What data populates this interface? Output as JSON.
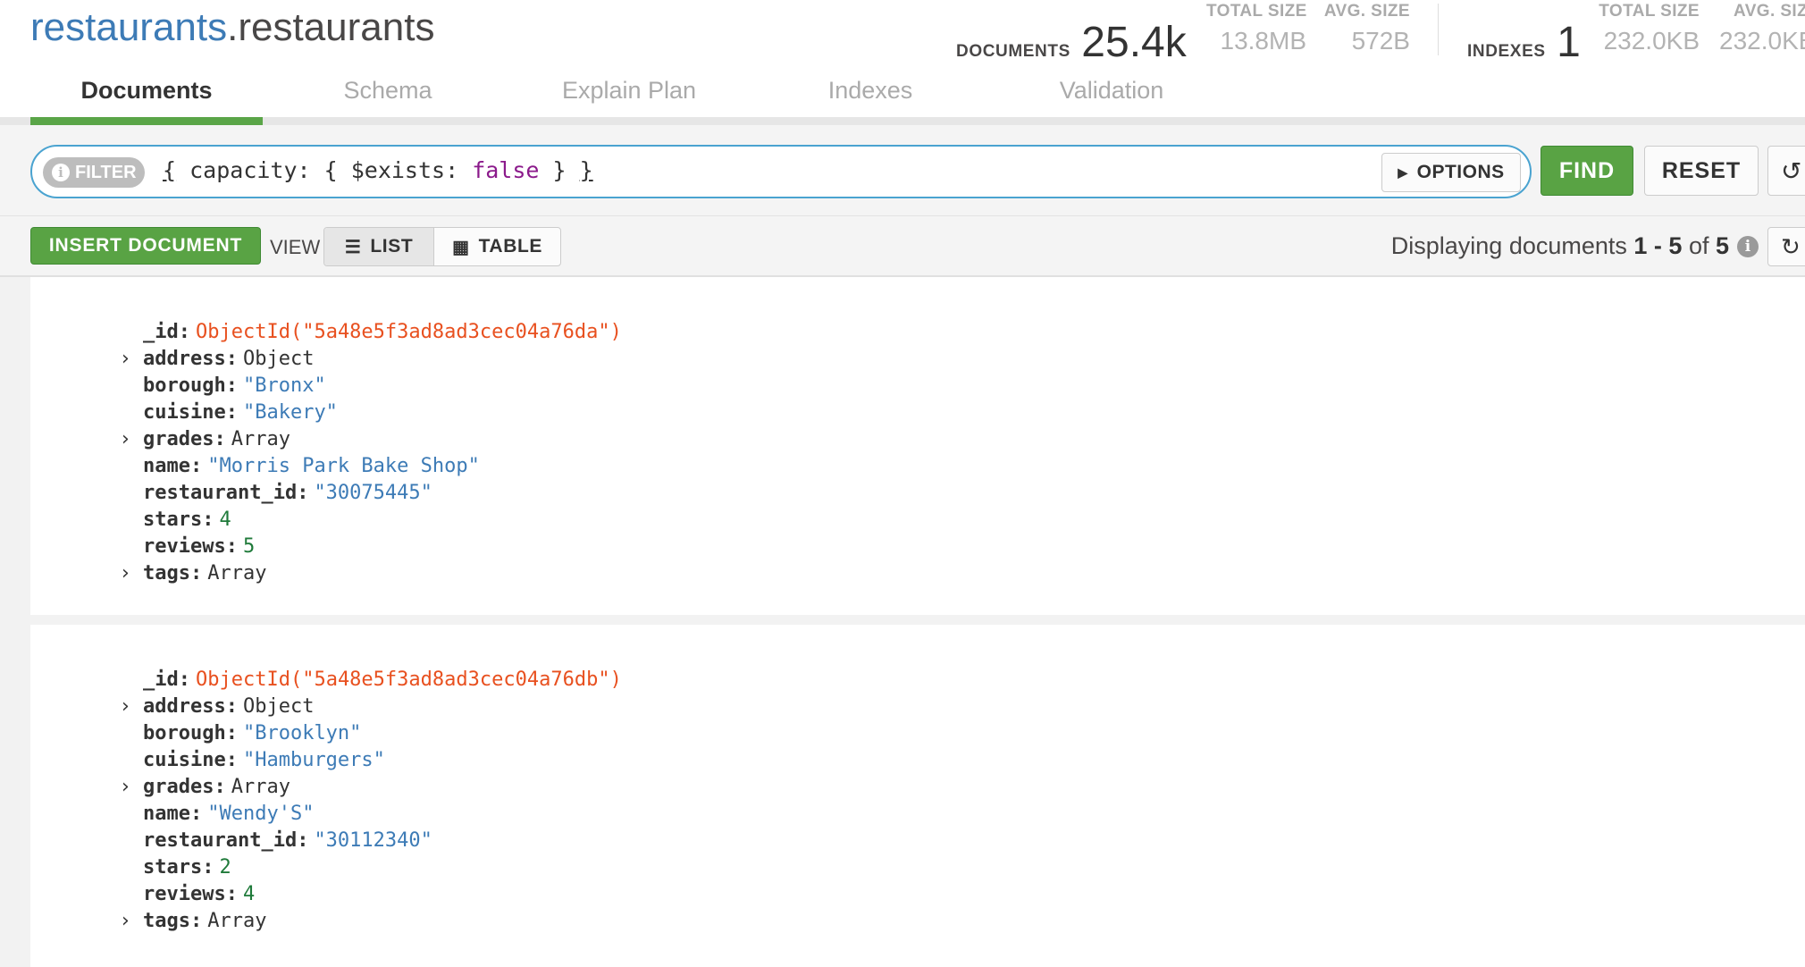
{
  "namespace": {
    "database": "restaurants",
    "separator": ".",
    "collection": "restaurants"
  },
  "stats": {
    "documents_label": "DOCUMENTS",
    "documents_value": "25.4k",
    "doc_total_size_label": "TOTAL SIZE",
    "doc_total_size_value": "13.8MB",
    "doc_avg_size_label": "AVG. SIZE",
    "doc_avg_size_value": "572B",
    "indexes_label": "INDEXES",
    "indexes_value": "1",
    "idx_total_size_label": "TOTAL SIZE",
    "idx_total_size_value": "232.0KB",
    "idx_avg_size_label": "AVG. SIZ",
    "idx_avg_size_value": "232.0KB"
  },
  "tabs": [
    {
      "label": "Documents",
      "active": true
    },
    {
      "label": "Schema",
      "active": false
    },
    {
      "label": "Explain Plan",
      "active": false
    },
    {
      "label": "Indexes",
      "active": false
    },
    {
      "label": "Validation",
      "active": false
    }
  ],
  "query": {
    "filter_label": "FILTER",
    "open_brace": "{",
    "text_pre": " capacity: { $exists: ",
    "keyword": "false",
    "text_post": " } ",
    "close_brace": "}",
    "options_label": "OPTIONS",
    "find_label": "FIND",
    "reset_label": "RESET",
    "history_icon": "history-icon"
  },
  "toolbar": {
    "insert_label": "INSERT DOCUMENT",
    "view_label": "VIEW",
    "list_label": "LIST",
    "table_label": "TABLE",
    "displaying_prefix": "Displaying documents ",
    "displaying_range": "1 - 5",
    "displaying_of": " of ",
    "displaying_total": "5",
    "info_icon": "info-icon",
    "refresh_icon": "refresh-icon"
  },
  "colors": {
    "accent_green": "#59a344",
    "link_blue": "#3d7bb6",
    "objectid_orange": "#e8501f",
    "number_green": "#1f7a3a",
    "filter_border": "#4aa3d0"
  },
  "documents": [
    {
      "fields": [
        {
          "key": "_id",
          "value": "ObjectId(\"5a48e5f3ad8ad3cec04a76da\")",
          "type": "objectid",
          "expandable": false
        },
        {
          "key": "address",
          "value": "Object",
          "type": "type",
          "expandable": true
        },
        {
          "key": "borough",
          "value": "\"Bronx\"",
          "type": "string",
          "expandable": false
        },
        {
          "key": "cuisine",
          "value": "\"Bakery\"",
          "type": "string",
          "expandable": false
        },
        {
          "key": "grades",
          "value": "Array",
          "type": "type",
          "expandable": true
        },
        {
          "key": "name",
          "value": "\"Morris Park Bake Shop\"",
          "type": "string",
          "expandable": false
        },
        {
          "key": "restaurant_id",
          "value": "\"30075445\"",
          "type": "string",
          "expandable": false
        },
        {
          "key": "stars",
          "value": "4",
          "type": "number",
          "expandable": false
        },
        {
          "key": "reviews",
          "value": "5",
          "type": "number",
          "expandable": false
        },
        {
          "key": "tags",
          "value": "Array",
          "type": "type",
          "expandable": true
        }
      ]
    },
    {
      "fields": [
        {
          "key": "_id",
          "value": "ObjectId(\"5a48e5f3ad8ad3cec04a76db\")",
          "type": "objectid",
          "expandable": false
        },
        {
          "key": "address",
          "value": "Object",
          "type": "type",
          "expandable": true
        },
        {
          "key": "borough",
          "value": "\"Brooklyn\"",
          "type": "string",
          "expandable": false
        },
        {
          "key": "cuisine",
          "value": "\"Hamburgers\"",
          "type": "string",
          "expandable": false
        },
        {
          "key": "grades",
          "value": "Array",
          "type": "type",
          "expandable": true
        },
        {
          "key": "name",
          "value": "\"Wendy'S\"",
          "type": "string",
          "expandable": false
        },
        {
          "key": "restaurant_id",
          "value": "\"30112340\"",
          "type": "string",
          "expandable": false
        },
        {
          "key": "stars",
          "value": "2",
          "type": "number",
          "expandable": false
        },
        {
          "key": "reviews",
          "value": "4",
          "type": "number",
          "expandable": false
        },
        {
          "key": "tags",
          "value": "Array",
          "type": "type",
          "expandable": true
        }
      ]
    }
  ]
}
